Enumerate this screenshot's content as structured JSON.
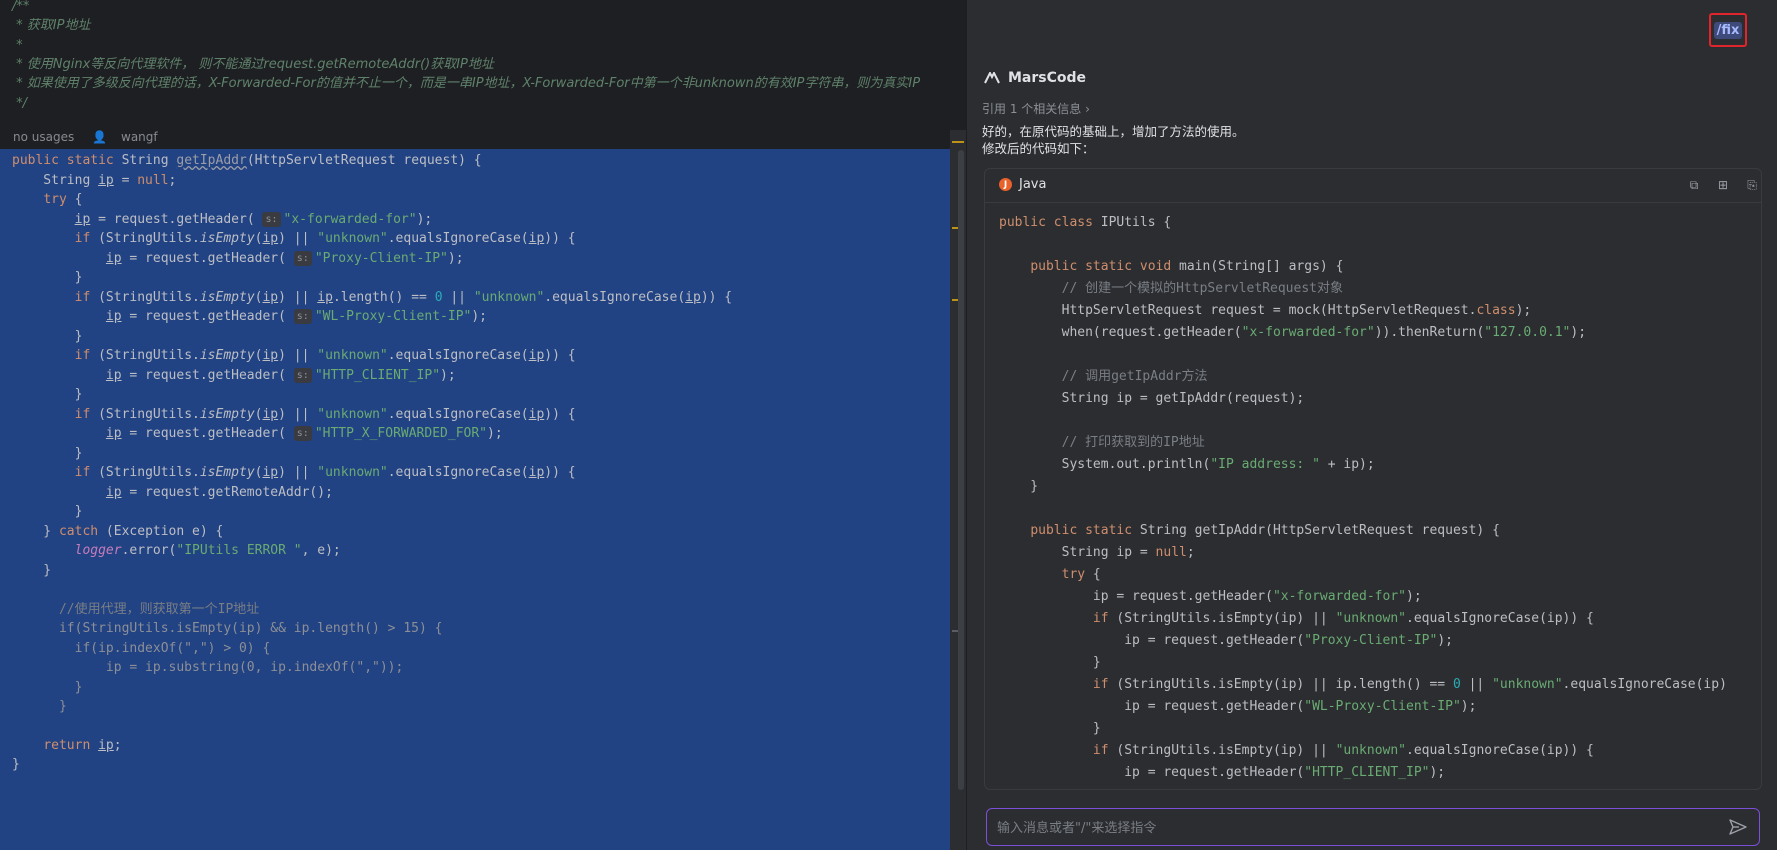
{
  "editor": {
    "doc_lines": [
      "/**",
      " * 获取IP地址",
      " *",
      " * 使用Nginx等反向代理软件， 则不能通过request.getRemoteAddr()获取IP地址",
      " * 如果使用了多级反向代理的话，X-Forwarded-For的值并不止一个，而是一串IP地址，X-Forwarded-For中第一个非unknown的有效IP字符串，则为真实IP",
      " */"
    ],
    "usages_hint": "no usages",
    "author_hint": "wangf",
    "param_hint": "s:",
    "strings": {
      "xff": "\"x-forwarded-for\"",
      "proxy": "\"Proxy-Client-IP\"",
      "wlproxy": "\"WL-Proxy-Client-IP\"",
      "http_client": "\"HTTP_CLIENT_IP\"",
      "http_xff": "\"HTTP_X_FORWARDED_FOR\"",
      "unknown": "\"unknown\"",
      "err": "\"IPUtils ERROR \""
    },
    "comment_proxy": "//使用代理，则获取第一个IP地址",
    "method_name": "getIpAddr"
  },
  "assistant": {
    "fix_label": "/fix",
    "brand": "MarsCode",
    "reference": "引用 1 个相关信息 ›",
    "message_line1": "好的，在原代码的基础上，增加了方法的使用。",
    "message_line2": "修改后的代码如下：",
    "code_lang": "Java",
    "input_placeholder": "输入消息或者\"/\"来选择指令"
  }
}
